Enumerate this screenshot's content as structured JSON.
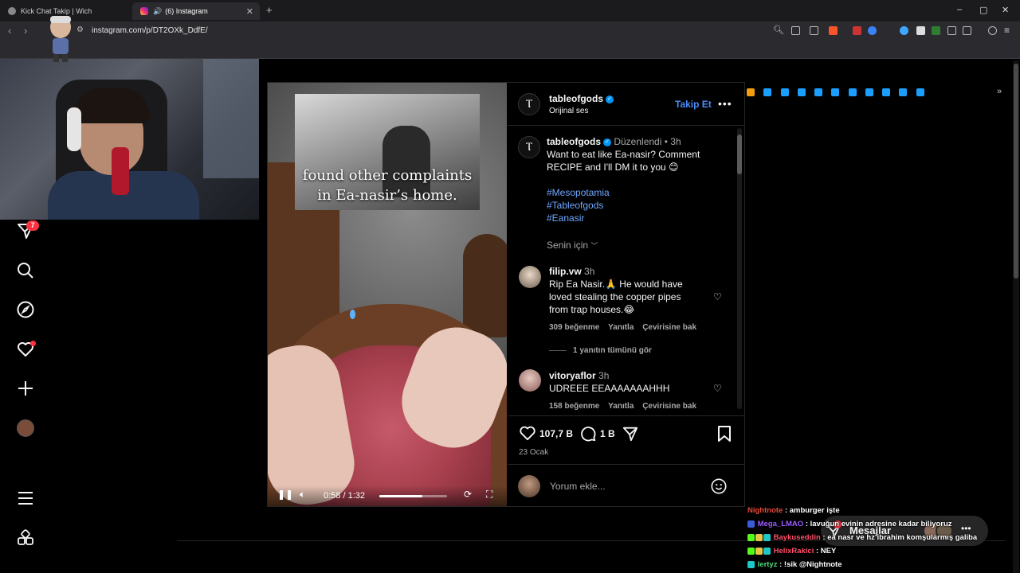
{
  "browser": {
    "tabs": [
      {
        "title": "Kick Chat Takip | Wich",
        "active": false
      },
      {
        "title": "(6) Instagram",
        "active": true
      }
    ],
    "url": "instagram.com/p/DT2OXk_DdfE/",
    "new_tab": "+",
    "window_controls": [
      "–",
      "▢",
      "✕"
    ]
  },
  "sidebar": {
    "notification_badge": "7",
    "items": [
      "messages-icon",
      "search-icon",
      "explore-icon",
      "notifications-icon",
      "create-icon",
      "profile-avatar",
      "more-menu-icon",
      "threads-icon"
    ]
  },
  "post": {
    "author": "tableofgods",
    "audio": "Orijinal ses",
    "follow_label": "Takip Et",
    "more_label": "•••",
    "caption_edited": "Düzenlendi",
    "caption_sep": "•",
    "caption_time": "3h",
    "caption_text": "Want to eat like Ea-nasir? Comment RECIPE and I'll DM it to you 😊",
    "hashtags": [
      "#Mesopotamia",
      "#Tableofgods",
      "#Eanasir"
    ],
    "sort_label": "Senin için",
    "video": {
      "caption_line1": "found other complaints",
      "caption_line2": "in Ea-nasir’s home.",
      "time": "0:58 / 1:32",
      "progress": 0.63
    },
    "comments": [
      {
        "user": "filip.vw",
        "time": "3h",
        "text": "Rip Ea Nasir.🙏 He would have loved stealing the copper pipes from trap houses.😂",
        "likes": "309 beğenme",
        "reply": "Yanıtla",
        "translate": "Çevirisine bak",
        "view_replies": "1 yanıtın tümünü gör"
      },
      {
        "user": "vitoryaflor",
        "time": "3h",
        "text": "UDREEE EEAAAAAAAHHH",
        "likes": "158 beğenme",
        "reply": "Yanıtla",
        "translate": "Çevirisine bak"
      }
    ],
    "like_count": "107,7 B",
    "comment_count": "1 B",
    "date": "23 Ocak",
    "comment_placeholder": "Yorum ekle..."
  },
  "messages_label": "Mesajlar",
  "chat_overlay": [
    {
      "user": "Nightnote",
      "text": ": amburger işte",
      "color": "#e84a3a"
    },
    {
      "user": "Mega_LMAO",
      "text": ": lavuğun evinin adresine kadar biliyoruz",
      "color": "#9b59ff"
    },
    {
      "user": "Baykuseddin",
      "text": ": ea nasr ve hz ibrahim komşularmış galiba",
      "color": "#ff4f6a"
    },
    {
      "user": "HelixRakici",
      "text": ": NEY",
      "color": "#ff4f6a"
    },
    {
      "user": "lertyz",
      "text": ": !sik @Nightnote",
      "color": "#52d67a"
    }
  ]
}
